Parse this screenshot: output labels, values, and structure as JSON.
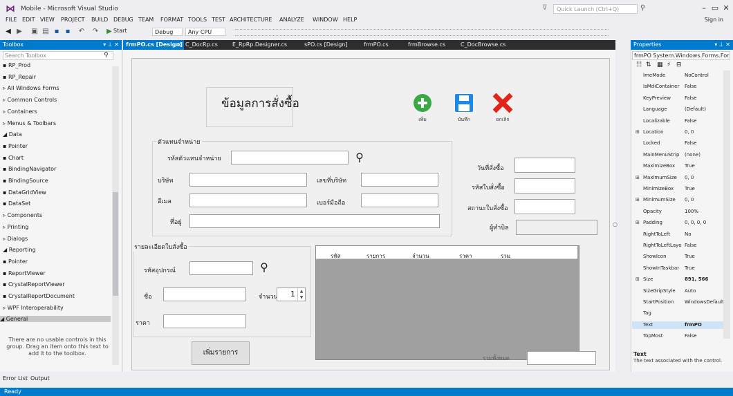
{
  "app": {
    "title": "Mobile - Microsoft Visual Studio",
    "quick_launch_placeholder": "Quick Launch (Ctrl+Q)",
    "sign_in": "Sign in",
    "status": "Ready"
  },
  "menu": [
    "FILE",
    "EDIT",
    "VIEW",
    "PROJECT",
    "BUILD",
    "DEBUG",
    "TEAM",
    "FORMAT",
    "TOOLS",
    "TEST",
    "ARCHITECTURE",
    "ANALYZE",
    "WINDOW",
    "HELP"
  ],
  "toolbar": {
    "start_label": "Start",
    "config": "Debug",
    "platform": "Any CPU"
  },
  "toolbox": {
    "title": "Toolbox",
    "search_placeholder": "Search Toolbox",
    "items": [
      {
        "label": "RP_Prod",
        "type": "item"
      },
      {
        "label": "RP_Repair",
        "type": "item"
      },
      {
        "label": "All Windows Forms",
        "type": "category"
      },
      {
        "label": "Common Controls",
        "type": "category"
      },
      {
        "label": "Containers",
        "type": "category"
      },
      {
        "label": "Menus & Toolbars",
        "type": "category"
      },
      {
        "label": "Data",
        "type": "category-open"
      },
      {
        "label": "Pointer",
        "type": "item"
      },
      {
        "label": "Chart",
        "type": "item"
      },
      {
        "label": "BindingNavigator",
        "type": "item"
      },
      {
        "label": "BindingSource",
        "type": "item"
      },
      {
        "label": "DataGridView",
        "type": "item"
      },
      {
        "label": "DataSet",
        "type": "item"
      },
      {
        "label": "Components",
        "type": "category"
      },
      {
        "label": "Printing",
        "type": "category"
      },
      {
        "label": "Dialogs",
        "type": "category"
      },
      {
        "label": "Reporting",
        "type": "category-open"
      },
      {
        "label": "Pointer",
        "type": "item"
      },
      {
        "label": "ReportViewer",
        "type": "item"
      },
      {
        "label": "CrystalReportViewer",
        "type": "item"
      },
      {
        "label": "CrystalReportDocument",
        "type": "item"
      },
      {
        "label": "WPF Interoperability",
        "type": "category"
      },
      {
        "label": "General",
        "type": "category-selected"
      }
    ],
    "empty_message": "There are no usable controls in this group. Drag an item onto this text to add it to the toolbox."
  },
  "tabs": [
    "frmPO.cs [Design]",
    "C_DocRp.cs",
    "E_RpRp.Designer.cs",
    "sPO.cs [Design]",
    "frmPO.cs",
    "frmBrowse.cs",
    "C_DocBrowse.cs"
  ],
  "form": {
    "heading": "ข้อมูลการสั่งซื้อ",
    "buttons": {
      "add": "เพิ่ม",
      "save": "บันทึก",
      "cancel": "ยกเลิก"
    },
    "supplier_group": {
      "title": "ตัวแทนจำหน่าย",
      "supplier_code_label": "รหัสตัวแทนจำหน่าย",
      "company_label": "บริษัท",
      "tax_id_label": "เลขที่บริษัท",
      "email_label": "อีเมล",
      "mobile_label": "เบอร์มือถือ",
      "address_label": "ที่อยู่"
    },
    "order_date_label": "วันที่สั่งซื้อ",
    "order_no_label": "รหัสใบสั่งซื้อ",
    "order_status_label": "สถานะใบสั่งซื้อ",
    "operator_label": "ผู้ทำบิล",
    "detail_group": {
      "title": "รายละเอียดใบสั่งซื้อ",
      "device_code_label": "รหัสอุปกรณ์",
      "name_label": "ชื่อ",
      "qty_label": "จำนวน",
      "qty_value": "1",
      "price_label": "ราคา",
      "add_item_button": "เพิ่มรายการ"
    },
    "grid_columns": [
      "รหัส",
      "รายการ",
      "จำนวน",
      "ราคา",
      "รวม"
    ],
    "total_label": "รวมทั้งหมด"
  },
  "properties": {
    "title": "Properties",
    "object": "frmPO System.Windows.Forms.Form",
    "rows": [
      {
        "name": "ImeMode",
        "value": "NoControl"
      },
      {
        "name": "IsMdiContainer",
        "value": "False"
      },
      {
        "name": "KeyPreview",
        "value": "False"
      },
      {
        "name": "Language",
        "value": "(Default)"
      },
      {
        "name": "Localizable",
        "value": "False"
      },
      {
        "name": "Location",
        "value": "0, 0",
        "expand": true
      },
      {
        "name": "Locked",
        "value": "False"
      },
      {
        "name": "MainMenuStrip",
        "value": "(none)"
      },
      {
        "name": "MaximizeBox",
        "value": "True"
      },
      {
        "name": "MaximumSize",
        "value": "0, 0",
        "expand": true
      },
      {
        "name": "MinimizeBox",
        "value": "True"
      },
      {
        "name": "MinimumSize",
        "value": "0, 0",
        "expand": true
      },
      {
        "name": "Opacity",
        "value": "100%"
      },
      {
        "name": "Padding",
        "value": "0, 0, 0, 0",
        "expand": true
      },
      {
        "name": "RightToLeft",
        "value": "No"
      },
      {
        "name": "RightToLeftLayout",
        "value": "False"
      },
      {
        "name": "ShowIcon",
        "value": "True"
      },
      {
        "name": "ShowInTaskbar",
        "value": "True"
      },
      {
        "name": "Size",
        "value": "891, 566",
        "expand": true,
        "bold": true
      },
      {
        "name": "SizeGripStyle",
        "value": "Auto"
      },
      {
        "name": "StartPosition",
        "value": "WindowsDefault"
      },
      {
        "name": "Tag",
        "value": ""
      },
      {
        "name": "Text",
        "value": "frmPO",
        "bold": true,
        "selected": true
      },
      {
        "name": "TopMost",
        "value": "False"
      }
    ],
    "desc_title": "Text",
    "desc": "The text associated with the control."
  },
  "bottom_tabs": [
    "Error List",
    "Output"
  ]
}
